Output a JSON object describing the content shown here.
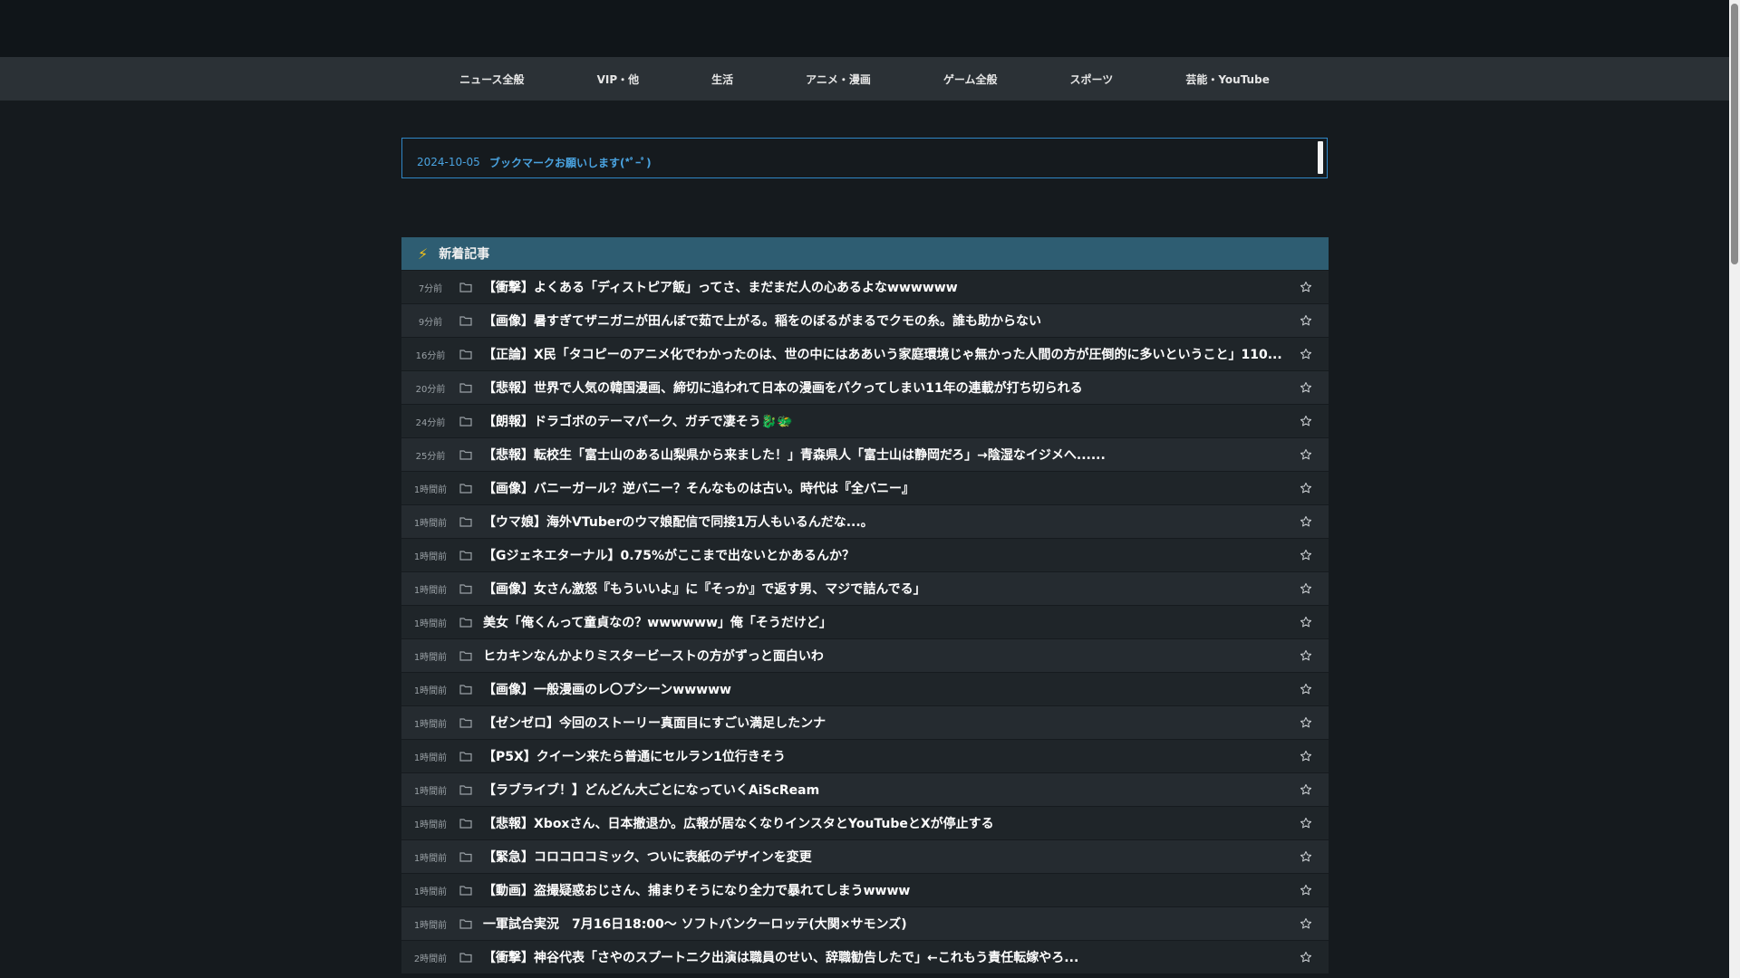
{
  "nav": {
    "categories": [
      "ニュース全般",
      "VIP・他",
      "生活",
      "アニメ・漫画",
      "ゲーム全般",
      "スポーツ",
      "芸能・YouTube"
    ]
  },
  "ticker": {
    "items": [
      {
        "date": "2024-10-05",
        "title": "ブックマークお願いします(*ﾟｰﾟ)"
      }
    ]
  },
  "panel": {
    "title": "新着記事",
    "articles": [
      {
        "time": "7分前",
        "title": "【衝撃】よくある「ディストピア飯」ってさ、まだまだ人の心あるよなwwwwww"
      },
      {
        "time": "9分前",
        "title": "【画像】暑すぎてザニガニが田んぼで茹で上がる。稲をのぼるがまるでクモの糸。誰も助からない"
      },
      {
        "time": "16分前",
        "title": "【正論】X民「タコピーのアニメ化でわかったのは、世の中にはああいう家庭環境じゃ無かった人間の方が圧倒的に多いということ」110..."
      },
      {
        "time": "20分前",
        "title": "【悲報】世界で人気の韓国漫画、締切に追われて日本の漫画をパクってしまい11年の連載が打ち切られる"
      },
      {
        "time": "24分前",
        "title": "【朗報】ドラゴボのテーマパーク、ガチで凄そう🐉🐲"
      },
      {
        "time": "25分前",
        "title": "【悲報】転校生「富士山のある山梨県から来ました！」青森県人「富士山は静岡だろ」→陰湿なイジメへ......"
      },
      {
        "time": "1時間前",
        "title": "【画像】バニーガール？逆バニー？そんなものは古い。時代は『全バニー』"
      },
      {
        "time": "1時間前",
        "title": "【ウマ娘】海外VTuberのウマ娘配信で同接1万人もいるんだな...。"
      },
      {
        "time": "1時間前",
        "title": "【Gジェネエターナル】0.75%がここまで出ないとかあるんか？"
      },
      {
        "time": "1時間前",
        "title": "【画像】女さん激怒『もういいよ』に『そっか』で返す男、マジで詰んでる」"
      },
      {
        "time": "1時間前",
        "title": "美女「俺くんって童貞なの？wwwwww」俺「そうだけど」"
      },
      {
        "time": "1時間前",
        "title": "ヒカキンなんかよりミスタービーストの方がずっと面白いわ"
      },
      {
        "time": "1時間前",
        "title": "【画像】一般漫画のレ〇プシーンwwwww"
      },
      {
        "time": "1時間前",
        "title": "【ゼンゼロ】今回のストーリー真面目にすごい満足したンナ"
      },
      {
        "time": "1時間前",
        "title": "【P5X】クイーン来たら普通にセルラン1位行きそう"
      },
      {
        "time": "1時間前",
        "title": "【ラブライブ！】どんどん大ごとになっていくAiScReam"
      },
      {
        "time": "1時間前",
        "title": "【悲報】Xboxさん、日本撤退か。広報が居なくなりインスタとYouTubeとXが停止する"
      },
      {
        "time": "1時間前",
        "title": "【緊急】コロコロコミック、ついに表紙のデザインを変更"
      },
      {
        "time": "1時間前",
        "title": "【動画】盗撮疑惑おじさん、捕まりそうになり全力で暴れてしまうwwww"
      },
      {
        "time": "1時間前",
        "title": "一軍試合実況　7月16日18:00〜 ソフトバンクーロッテ(大関×サモンズ)"
      },
      {
        "time": "2時間前",
        "title": "【衝撃】神谷代表「さやのスプートニク出演は職員のせい、辞職勧告したで」←これもう責任転嫁やろ..."
      }
    ]
  },
  "colors": {
    "panel_header": "#2e5d72",
    "link_blue": "#4aa3e0",
    "bolt": "#f3c21b"
  }
}
